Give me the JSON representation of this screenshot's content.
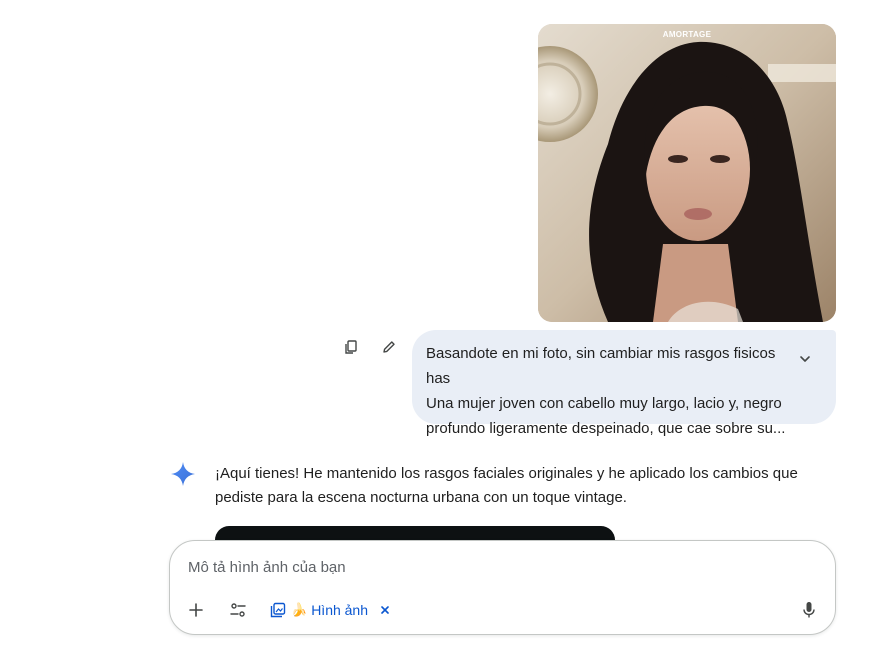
{
  "photo": {
    "caption": "AMORTAGE",
    "description_icon": "portrait-photo"
  },
  "message_actions": {
    "copy_icon": "copy-icon",
    "edit_icon": "pencil-icon"
  },
  "user_message": {
    "text": "Basandote en mi foto, sin cambiar mis rasgos fisicos has\nUna mujer joven con cabello muy largo, lacio y, negro\nprofundo ligeramente despeinado, que cae sobre su...",
    "expand_icon": "chevron-down-icon"
  },
  "assistant": {
    "icon": "sparkle-icon",
    "text": "¡Aquí tienes! He mantenido los rasgos faciales originales y he aplicado los cambios que pediste para la escena nocturna urbana con un toque vintage."
  },
  "composer": {
    "placeholder": "Mô tả hình ảnh của bạn",
    "value": "",
    "add_icon": "plus-icon",
    "tools_icon": "sliders-icon",
    "chip": {
      "icon": "image-gallery-icon",
      "emoji": "🍌",
      "label": "Hình ảnh",
      "close_icon": "close-icon"
    },
    "mic_icon": "microphone-icon"
  },
  "colors": {
    "bubble_bg": "#e9eef6",
    "accent": "#0b57d0",
    "sparkle": "#4a86e8",
    "text": "#1f1f1f",
    "border": "#c4c7c5"
  }
}
